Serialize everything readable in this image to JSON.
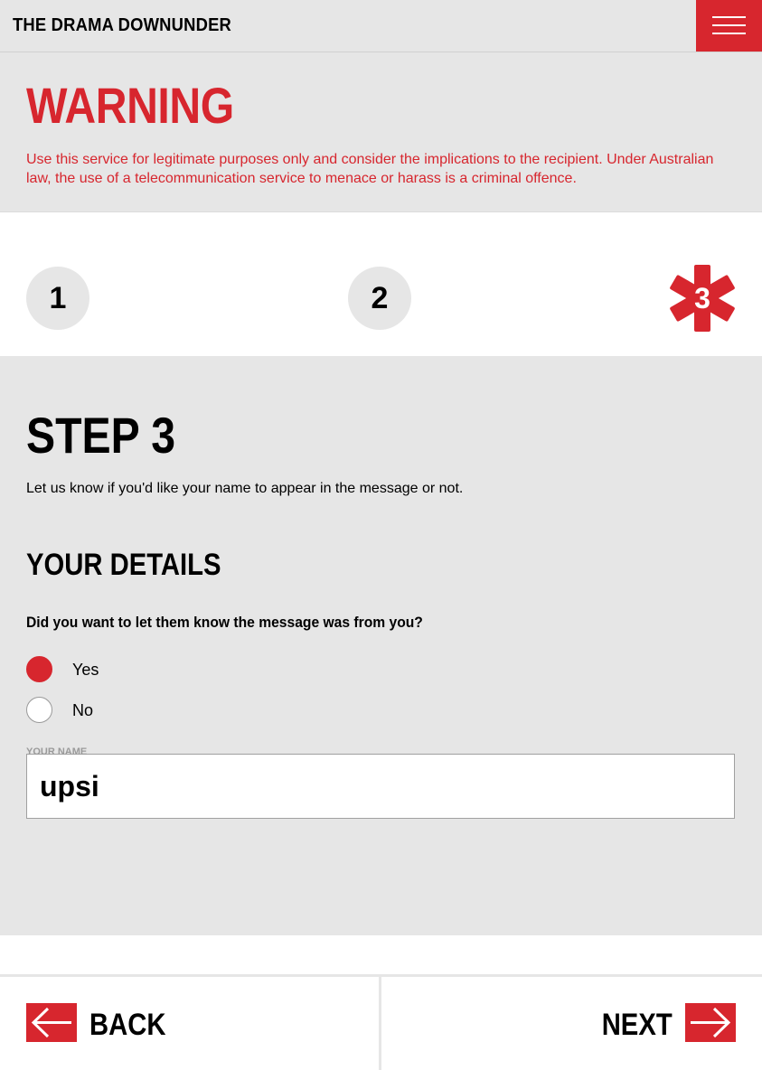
{
  "header": {
    "brand": "THE DRAMA DOWNUNDER",
    "menu_icon": "hamburger-menu-icon"
  },
  "warning": {
    "title": "WARNING",
    "text": "Use this service for legitimate purposes only and consider the implications to the recipient. Under Australian law, the use of a telecommunication service to menace or harass is a criminal offence."
  },
  "steps": {
    "items": [
      {
        "label": "1"
      },
      {
        "label": "2"
      },
      {
        "label": "3"
      }
    ],
    "active_index": 2
  },
  "main": {
    "step_title": "STEP 3",
    "step_description": "Let us know if you'd like your name to appear in the message or not.",
    "section_title": "YOUR DETAILS",
    "question": "Did you want to let them know the message was from you?",
    "options": [
      {
        "label": "Yes",
        "selected": true
      },
      {
        "label": "No",
        "selected": false
      }
    ],
    "name_label": "YOUR NAME",
    "name_value": "upsi"
  },
  "footer": {
    "back_label": "BACK",
    "next_label": "NEXT",
    "back_icon": "arrow-left-icon",
    "next_icon": "arrow-right-icon"
  },
  "colors": {
    "accent": "#d7262e",
    "panel_bg": "#e6e6e6",
    "white": "#ffffff"
  }
}
